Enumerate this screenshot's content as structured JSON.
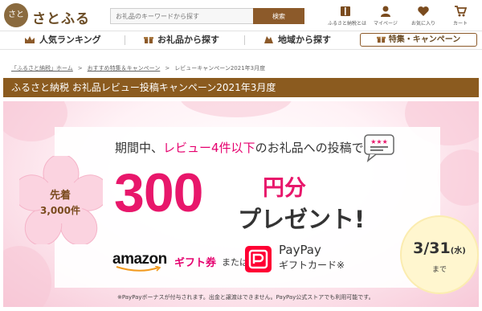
{
  "header": {
    "logo_mark": "さと",
    "logo_text": "さとふる",
    "search": {
      "placeholder": "お礼品のキーワードから探す",
      "button": "検索"
    },
    "nav_icons": [
      {
        "icon": "book-icon",
        "label": "ふるさと納税とは"
      },
      {
        "icon": "person-icon",
        "label": "マイページ"
      },
      {
        "icon": "heart-icon",
        "label": "お気に入り"
      },
      {
        "icon": "cart-icon",
        "label": "カート"
      }
    ]
  },
  "navbar": {
    "items": [
      {
        "icon": "crown-icon",
        "label": "人気ランキング"
      },
      {
        "icon": "gift-icon",
        "label": "お礼品から探す"
      },
      {
        "icon": "map-icon",
        "label": "地域から探す"
      }
    ],
    "campaign": {
      "icon": "gift-icon",
      "label": "特集・キャンペーン"
    }
  },
  "breadcrumb": [
    "「ふるさと納税」ホーム",
    "おすすめ特集＆キャンペーン",
    "レビューキャンペーン2021年3月度"
  ],
  "page_title": "ふるさと納税 お礼品レビュー投稿キャンペーン2021年3月度",
  "banner": {
    "badge_line1": "先着",
    "badge_line2": "3,000件",
    "headline_pre": "期間中、",
    "headline_highlight": "レビュー4件以下",
    "headline_post": "のお礼品への投稿で",
    "amount": "300",
    "amount_unit": "円分",
    "present": "プレゼント!",
    "amazon_brand": "amazon",
    "amazon_gift": "ギフト券",
    "or_text": "または",
    "paypay_name": "PayPay",
    "paypay_gift": "ギフトカード※",
    "deadline_date": "3/31",
    "deadline_day": "(水)",
    "deadline_until": "まで",
    "footnote": "※PayPayボーナスが付与されます。出金と譲渡はできません。PayPay公式ストアでも利用可能です。",
    "colors": {
      "accent": "#e8176b",
      "title_bar": "#8b5b1f",
      "paypay": "#ff0033"
    }
  }
}
